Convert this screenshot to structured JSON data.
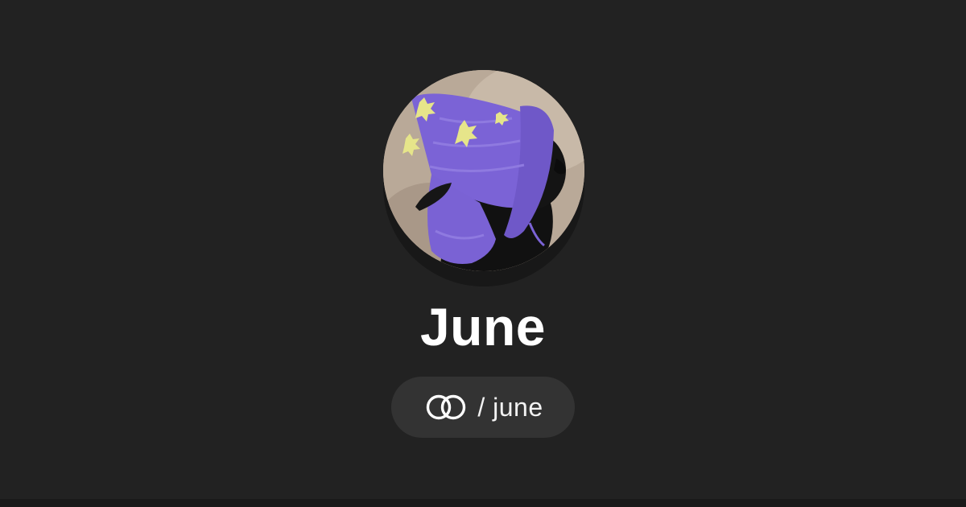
{
  "profile": {
    "name": "June",
    "handle": "/ june",
    "avatar_description_icon": "cat-in-purple-wizard-hat-avatar"
  },
  "brand": {
    "logo_icon": "interlocking-rings-logo-icon"
  },
  "colors": {
    "background": "#222222",
    "pill": "#333333",
    "text": "#ffffff",
    "hat_purple": "#7b63d6",
    "hat_stars": "#e6e58a"
  }
}
